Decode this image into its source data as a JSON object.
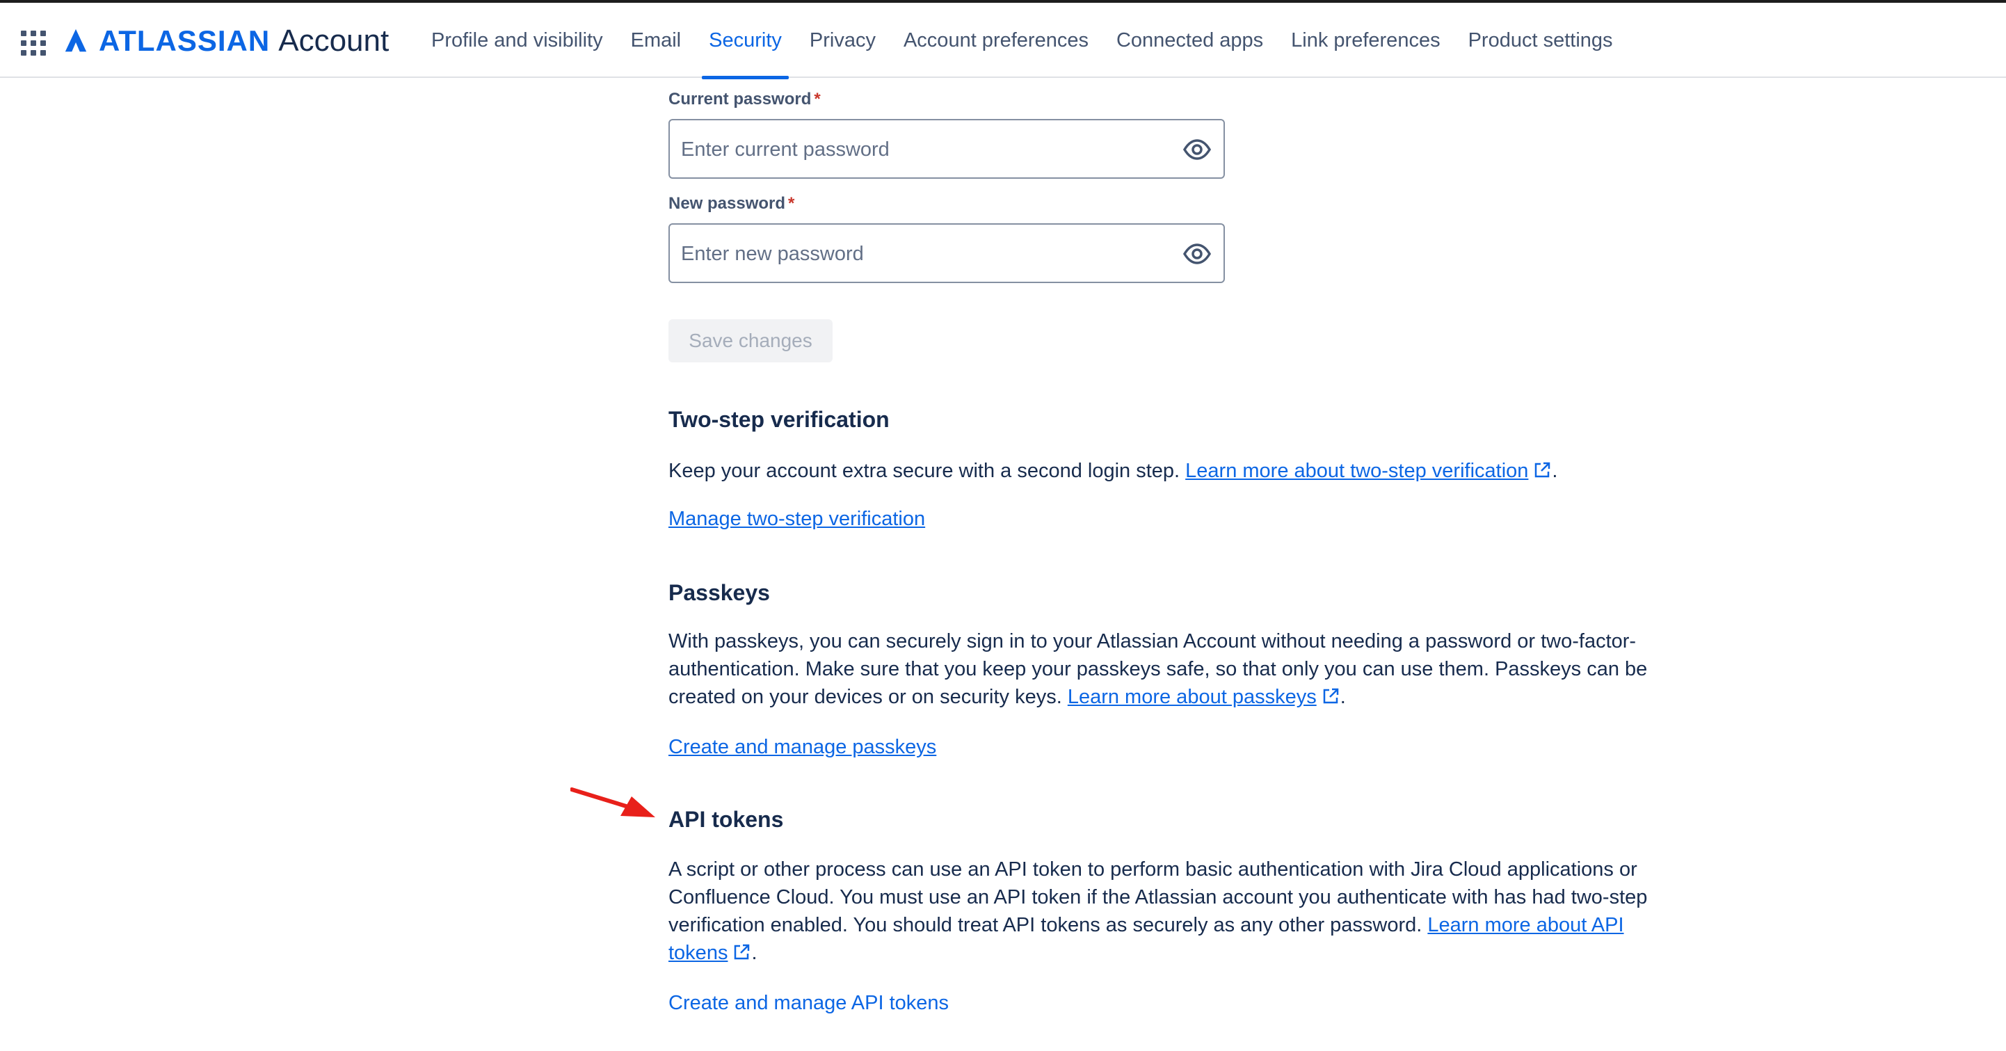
{
  "header": {
    "brand": "ATLASSIAN",
    "product": "Account",
    "nav": [
      {
        "label": "Profile and visibility",
        "active": false
      },
      {
        "label": "Email",
        "active": false
      },
      {
        "label": "Security",
        "active": true
      },
      {
        "label": "Privacy",
        "active": false
      },
      {
        "label": "Account preferences",
        "active": false
      },
      {
        "label": "Connected apps",
        "active": false
      },
      {
        "label": "Link preferences",
        "active": false
      },
      {
        "label": "Product settings",
        "active": false
      }
    ]
  },
  "password_form": {
    "current_label": "Current password",
    "current_placeholder": "Enter current password",
    "new_label": "New password",
    "new_placeholder": "Enter new password",
    "required_marker": "*",
    "save_label": "Save changes"
  },
  "two_step": {
    "title": "Two-step verification",
    "text": "Keep your account extra secure with a second login step. ",
    "learn_more": "Learn more about two-step verification",
    "suffix": ".",
    "manage_link": "Manage two-step verification"
  },
  "passkeys": {
    "title": "Passkeys",
    "text_line1": "With passkeys, you can securely sign in to your Atlassian Account without needing a password or two-factor-",
    "text_line2": "authentication. Make sure that you keep your passkeys safe, so that only you can use them. Passkeys can be",
    "text_line3": "created on your devices or on security keys. ",
    "learn_more": "Learn more about passkeys",
    "suffix": ".",
    "manage_link": "Create and manage passkeys"
  },
  "api_tokens": {
    "title": "API tokens",
    "text_line1": "A script or other process can use an API token to perform basic authentication with Jira Cloud applications or",
    "text_line2": "Confluence Cloud. You must use an API token if the Atlassian account you authenticate with has had two-step",
    "text_line3": "verification enabled. You should treat API tokens as securely as any other password. ",
    "learn_more_part1": "Learn more about API",
    "learn_more_part2": "tokens",
    "suffix": ".",
    "manage_link": "Create and manage API tokens"
  },
  "colors": {
    "accent": "#0c66e4",
    "text": "#172b4d",
    "annotation_arrow": "#e8201a"
  },
  "icons": {
    "app_switcher": "grid-icon",
    "logo": "atlassian-logo-icon",
    "reveal": "eye-icon",
    "external": "external-link-icon",
    "annotation": "red-arrow-icon"
  }
}
